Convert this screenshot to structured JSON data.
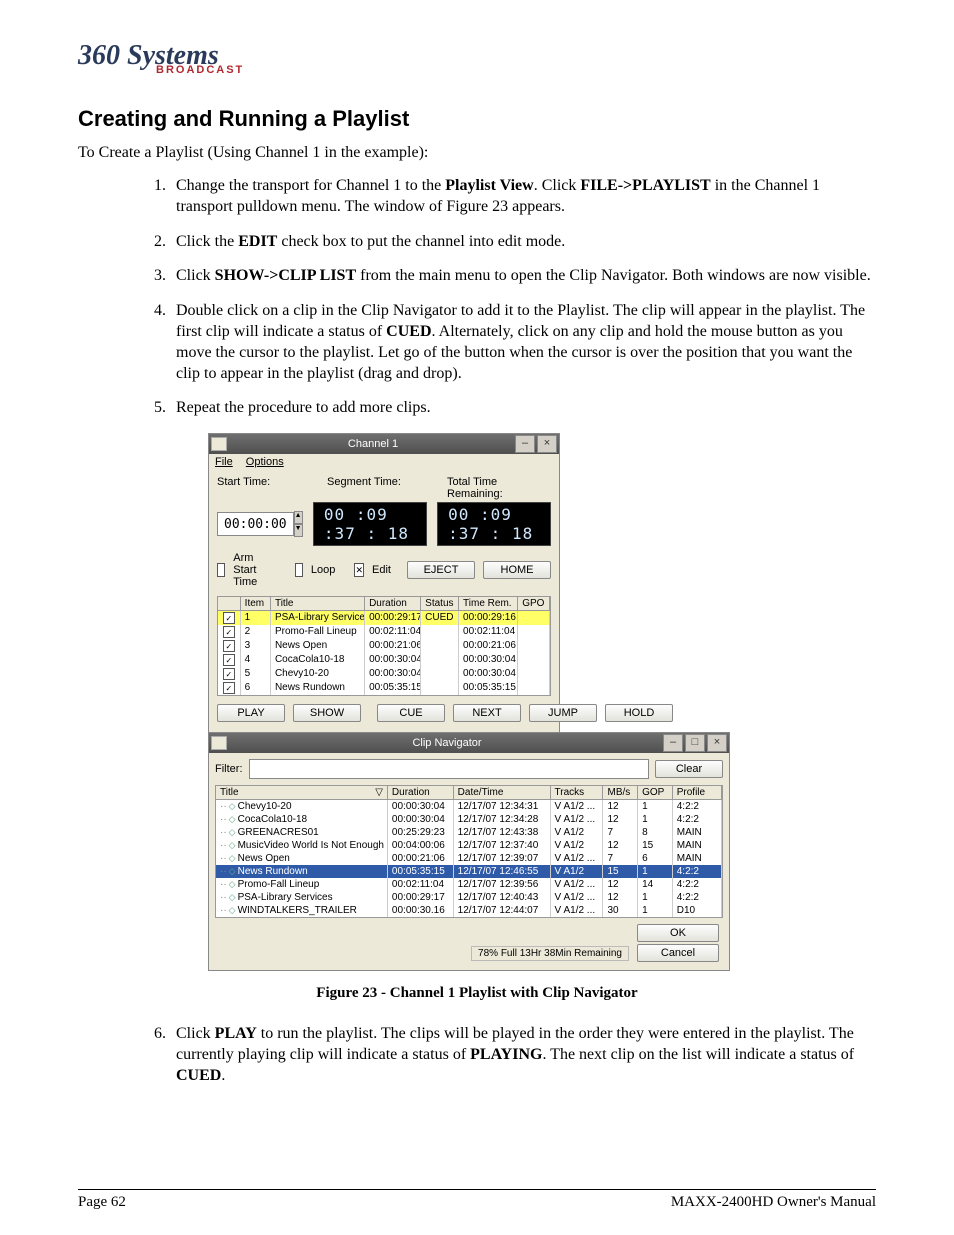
{
  "logo": {
    "brand_script": "360 Systems",
    "brand_sub": "BROADCAST"
  },
  "heading": "Creating and Running a Playlist",
  "intro": "To Create a Playlist (Using Channel 1 in the example):",
  "steps": {
    "s1a": "Change the transport for Channel 1 to the ",
    "s1b": "Playlist View",
    "s1c": ". Click ",
    "s1d": "FILE->PLAYLIST",
    "s1e": " in the Channel 1 transport pulldown menu. The window of Figure 23 appears.",
    "s2a": "Click the ",
    "s2b": "EDIT",
    "s2c": " check box to put the channel into edit mode.",
    "s3a": "Click ",
    "s3b": "SHOW->CLIP LIST",
    "s3c": " from the main menu to open the Clip Navigator. Both windows are now visible.",
    "s4a": "Double click on a clip in the Clip Navigator to add it to the Playlist. The clip will appear in the playlist. The first clip will indicate a status of ",
    "s4b": "CUED",
    "s4c": ".  Alternately, click on any clip and hold the mouse button as you move the cursor to the playlist.  Let go of the button when the cursor is over the position that you want the clip to appear in the playlist (drag and drop).",
    "s5": "Repeat the procedure to add more clips.",
    "s6a": "Click ",
    "s6b": "PLAY",
    "s6c": " to run the playlist. The clips will be played in the order they were entered in the playlist. The currently playing clip will indicate a status of ",
    "s6d": "PLAYING",
    "s6e": ". The next clip on the list will indicate a status of ",
    "s6f": "CUED",
    "s6g": "."
  },
  "figure_caption": "Figure 23 - Channel 1 Playlist with Clip Navigator",
  "ch_win": {
    "title": "Channel 1",
    "menu_file": "File",
    "menu_options": "Options",
    "lbl_start": "Start Time:",
    "lbl_seg": "Segment Time:",
    "lbl_total": "Total Time Remaining:",
    "start_val": "00:00:00",
    "seg_val": "00 :09 :37 : 18",
    "total_val": "00 :09 :37 : 18",
    "chk_arm": "Arm Start Time",
    "chk_loop": "Loop",
    "chk_edit": "Edit",
    "btn_eject": "EJECT",
    "btn_home": "HOME",
    "head_item": "Item",
    "head_title": "Title",
    "head_dur": "Duration",
    "head_stat": "Status",
    "head_tr": "Time Rem.",
    "head_gpo": "GPO",
    "rows": [
      {
        "n": "1",
        "t": "PSA-Library Services",
        "d": "00:00:29:17",
        "s": "CUED",
        "r": "00:00:29:16",
        "cued": true
      },
      {
        "n": "2",
        "t": "Promo-Fall Lineup",
        "d": "00:02:11:04",
        "s": "",
        "r": "00:02:11:04"
      },
      {
        "n": "3",
        "t": "News Open",
        "d": "00:00:21:06",
        "s": "",
        "r": "00:00:21:06"
      },
      {
        "n": "4",
        "t": "CocaCola10-18",
        "d": "00:00:30:04",
        "s": "",
        "r": "00:00:30:04"
      },
      {
        "n": "5",
        "t": "Chevy10-20",
        "d": "00:00:30:04",
        "s": "",
        "r": "00:00:30:04"
      },
      {
        "n": "6",
        "t": "News Rundown",
        "d": "00:05:35:15",
        "s": "",
        "r": "00:05:35:15"
      }
    ],
    "btn_play": "PLAY",
    "btn_show": "SHOW",
    "btn_cue": "CUE",
    "btn_next": "NEXT",
    "btn_jump": "JUMP",
    "btn_hold": "HOLD"
  },
  "clipnav": {
    "title": "Clip Navigator",
    "lbl_filter": "Filter:",
    "btn_clear": "Clear",
    "head_title": "Title",
    "head_dur": "Duration",
    "head_dt": "Date/Time",
    "head_trk": "Tracks",
    "head_mb": "MB/s",
    "head_gop": "GOP",
    "head_prof": "Profile",
    "rows": [
      {
        "t": "Chevy10-20",
        "d": "00:00:30:04",
        "dt": "12/17/07 12:34:31",
        "trk": "V A1/2 ...",
        "mb": "12",
        "g": "1",
        "p": "4:2:2"
      },
      {
        "t": "CocaCola10-18",
        "d": "00:00:30:04",
        "dt": "12/17/07 12:34:28",
        "trk": "V A1/2 ...",
        "mb": "12",
        "g": "1",
        "p": "4:2:2"
      },
      {
        "t": "GREENACRES01",
        "d": "00:25:29:23",
        "dt": "12/17/07 12:43:38",
        "trk": "V A1/2",
        "mb": "7",
        "g": "8",
        "p": "MAIN"
      },
      {
        "t": "MusicVideo World Is Not Enough",
        "d": "00:04:00:06",
        "dt": "12/17/07 12:37:40",
        "trk": "V A1/2",
        "mb": "12",
        "g": "15",
        "p": "MAIN"
      },
      {
        "t": "News Open",
        "d": "00:00:21:06",
        "dt": "12/17/07 12:39:07",
        "trk": "V A1/2 ...",
        "mb": "7",
        "g": "6",
        "p": "MAIN"
      },
      {
        "t": "News Rundown",
        "d": "00:05:35:15",
        "dt": "12/17/07 12:46:55",
        "trk": "V A1/2",
        "mb": "15",
        "g": "1",
        "p": "4:2:2",
        "sel": true
      },
      {
        "t": "Promo-Fall Lineup",
        "d": "00:02:11:04",
        "dt": "12/17/07 12:39:56",
        "trk": "V A1/2 ...",
        "mb": "12",
        "g": "14",
        "p": "4:2:2"
      },
      {
        "t": "PSA-Library Services",
        "d": "00:00:29:17",
        "dt": "12/17/07 12:40:43",
        "trk": "V A1/2 ...",
        "mb": "12",
        "g": "1",
        "p": "4:2:2"
      },
      {
        "t": "WINDTALKERS_TRAILER",
        "d": "00:00:30.16",
        "dt": "12/17/07 12:44:07",
        "trk": "V A1/2 ...",
        "mb": "30",
        "g": "1",
        "p": "D10"
      }
    ],
    "btn_ok": "OK",
    "btn_cancel": "Cancel",
    "status": "78% Full  13Hr 38Min Remaining"
  },
  "footer_left": "Page 62",
  "footer_right": "MAXX-2400HD Owner's Manual"
}
